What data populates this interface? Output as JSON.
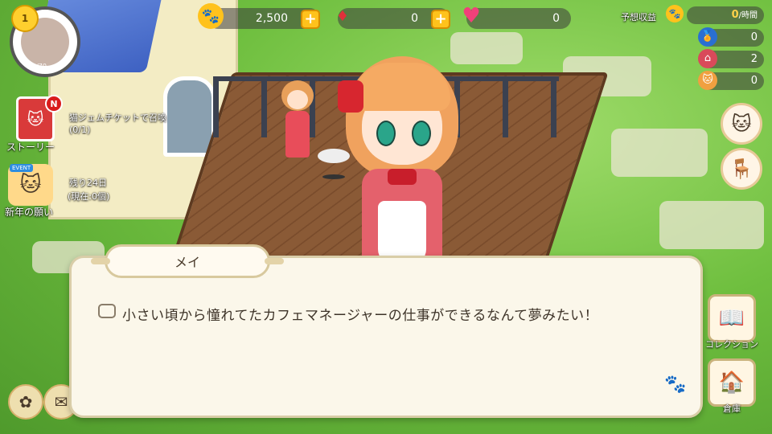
{
  "hud": {
    "level": "1",
    "exp": "0/70",
    "paw_coins": "2,500",
    "gems": "0",
    "hearts": "0"
  },
  "income": {
    "label": "予想収益",
    "value": "0",
    "unit": "/時間"
  },
  "right_stats": [
    {
      "icon": "medal-icon",
      "value": "0"
    },
    {
      "icon": "house-icon",
      "value": "2"
    },
    {
      "icon": "cat-icon",
      "value": "0"
    }
  ],
  "left_menu": {
    "story_badge": "N",
    "story_label": "ストーリー",
    "ticket_text": "猫ジェムチケットで召喚",
    "ticket_count": "(0/1)",
    "event_tag": "EVENT",
    "event_remaining": "残り24日",
    "event_current": "(現在:0個)",
    "event_label": "新年の願い"
  },
  "dialogue": {
    "speaker": "メイ",
    "text": "小さい頃から憧れてたカフェマネージャーの仕事ができるなんて夢みたい！"
  },
  "right_menu": {
    "collection_label": "コレクション",
    "storage_label": "倉庫"
  },
  "colors": {
    "gold": "#ffc21c",
    "gem": "#e0303a",
    "heart": "#f0407a",
    "dialog_bg": "#fbf7ea"
  }
}
